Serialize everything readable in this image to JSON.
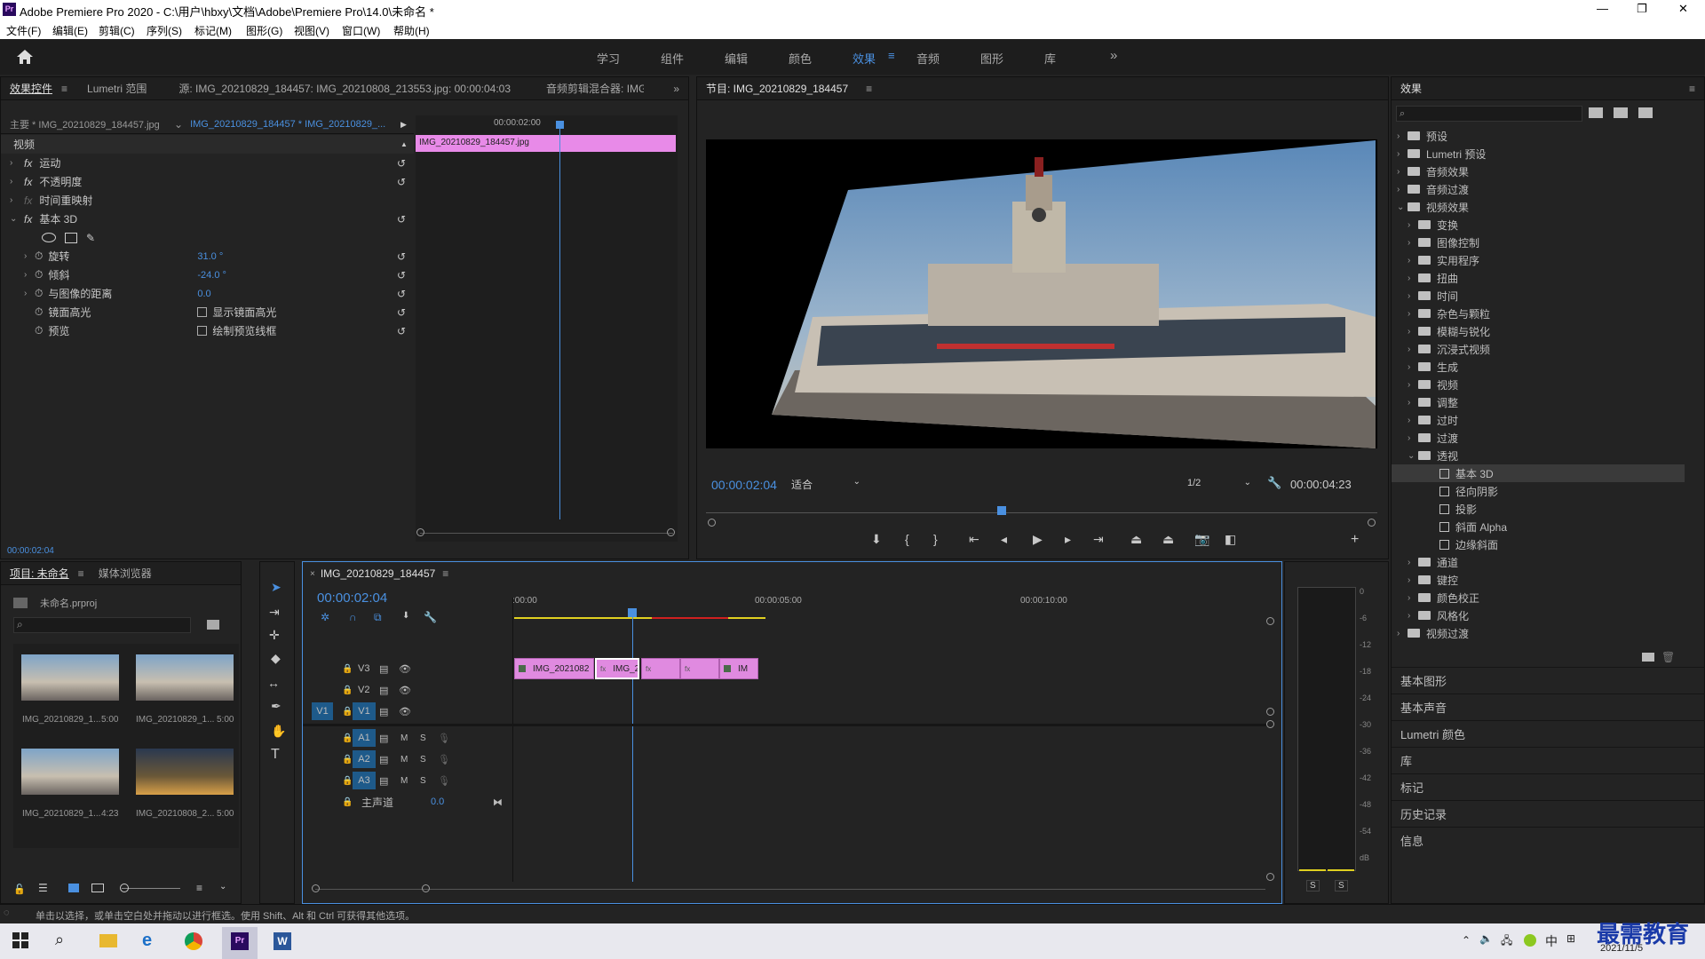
{
  "titlebar": {
    "title": "Adobe Premiere Pro 2020 - C:\\用户\\hbxy\\文档\\Adobe\\Premiere Pro\\14.0\\未命名 *",
    "minimize": "—",
    "maximize": "❐",
    "close": "✕"
  },
  "menu": [
    "文件(F)",
    "编辑(E)",
    "剪辑(C)",
    "序列(S)",
    "标记(M)",
    "图形(G)",
    "视图(V)",
    "窗口(W)",
    "帮助(H)"
  ],
  "workspaces": [
    "学习",
    "组件",
    "编辑",
    "颜色",
    "效果",
    "音频",
    "图形",
    "库"
  ],
  "active_workspace": "效果",
  "effect_controls": {
    "tabs": [
      "效果控件",
      "Lumetri 范围",
      "源: IMG_20210829_184457: IMG_20210808_213553.jpg: 00:00:04:03",
      "音频剪辑混合器: IMG_2("
    ],
    "master": "主要 * IMG_20210829_184457.jpg",
    "sequence": "IMG_20210829_184457 * IMG_20210829_...",
    "timecode_ruler": "00:00:02:00",
    "clip_name": "IMG_20210829_184457.jpg",
    "video_header": "视频",
    "rows": [
      {
        "label": "运动"
      },
      {
        "label": "不透明度"
      },
      {
        "label": "时间重映射"
      },
      {
        "label": "基本 3D"
      }
    ],
    "params": [
      {
        "label": "旋转",
        "value": "31.0 °"
      },
      {
        "label": "倾斜",
        "value": "-24.0 °"
      },
      {
        "label": "与图像的距离",
        "value": "0.0"
      },
      {
        "label": "镜面高光",
        "value": "显示镜面高光"
      },
      {
        "label": "预览",
        "value": "绘制预览线框"
      }
    ],
    "current_time": "00:00:02:04"
  },
  "program": {
    "title": "节目: IMG_20210829_184457",
    "timecode": "00:00:02:04",
    "fit": "适合",
    "resolution": "1/2",
    "duration": "00:00:04:23",
    "playhead_fraction": 0.44
  },
  "effects_panel": {
    "title": "效果",
    "tree": [
      {
        "label": "预设",
        "level": 0,
        "type": "folder",
        "open": false
      },
      {
        "label": "Lumetri 预设",
        "level": 0,
        "type": "folder",
        "open": false
      },
      {
        "label": "音频效果",
        "level": 0,
        "type": "folder",
        "open": false
      },
      {
        "label": "音频过渡",
        "level": 0,
        "type": "folder",
        "open": false
      },
      {
        "label": "视频效果",
        "level": 0,
        "type": "folder",
        "open": true
      },
      {
        "label": "变换",
        "level": 1,
        "type": "folder",
        "open": false
      },
      {
        "label": "图像控制",
        "level": 1,
        "type": "folder",
        "open": false
      },
      {
        "label": "实用程序",
        "level": 1,
        "type": "folder",
        "open": false
      },
      {
        "label": "扭曲",
        "level": 1,
        "type": "folder",
        "open": false
      },
      {
        "label": "时间",
        "level": 1,
        "type": "folder",
        "open": false
      },
      {
        "label": "杂色与颗粒",
        "level": 1,
        "type": "folder",
        "open": false
      },
      {
        "label": "模糊与锐化",
        "level": 1,
        "type": "folder",
        "open": false
      },
      {
        "label": "沉浸式视频",
        "level": 1,
        "type": "folder",
        "open": false
      },
      {
        "label": "生成",
        "level": 1,
        "type": "folder",
        "open": false
      },
      {
        "label": "视频",
        "level": 1,
        "type": "folder",
        "open": false
      },
      {
        "label": "调整",
        "level": 1,
        "type": "folder",
        "open": false
      },
      {
        "label": "过时",
        "level": 1,
        "type": "folder",
        "open": false
      },
      {
        "label": "过渡",
        "level": 1,
        "type": "folder",
        "open": false
      },
      {
        "label": "透视",
        "level": 1,
        "type": "folder",
        "open": true
      },
      {
        "label": "基本 3D",
        "level": 2,
        "type": "preset",
        "selected": true
      },
      {
        "label": "径向阴影",
        "level": 2,
        "type": "preset"
      },
      {
        "label": "投影",
        "level": 2,
        "type": "preset"
      },
      {
        "label": "斜面 Alpha",
        "level": 2,
        "type": "preset"
      },
      {
        "label": "边缘斜面",
        "level": 2,
        "type": "preset"
      },
      {
        "label": "通道",
        "level": 1,
        "type": "folder",
        "open": false
      },
      {
        "label": "键控",
        "level": 1,
        "type": "folder",
        "open": false
      },
      {
        "label": "颜色校正",
        "level": 1,
        "type": "folder",
        "open": false
      },
      {
        "label": "风格化",
        "level": 1,
        "type": "folder",
        "open": false
      },
      {
        "label": "视频过渡",
        "level": 0,
        "type": "folder",
        "open": false
      }
    ],
    "sections": [
      "基本图形",
      "基本声音",
      "Lumetri 颜色",
      "库",
      "标记",
      "历史记录",
      "信息"
    ]
  },
  "project": {
    "tabs": [
      "项目: 未命名",
      "媒体浏览器"
    ],
    "file": "未命名.prproj",
    "items": [
      {
        "name": "IMG_20210829_1...",
        "dur": "5:00"
      },
      {
        "name": "IMG_20210829_1...",
        "dur": "5:00"
      },
      {
        "name": "IMG_20210829_1...",
        "dur": "4:23"
      },
      {
        "name": "IMG_20210808_2...",
        "dur": "5:00"
      }
    ]
  },
  "timeline": {
    "tab": "IMG_20210829_184457",
    "timecode": "00:00:02:04",
    "ruler": [
      ":00:00",
      "00:00:05:00",
      "00:00:10:00"
    ],
    "video_tracks": [
      "V3",
      "V2",
      "V1"
    ],
    "audio_tracks": [
      "A1",
      "A2",
      "A3"
    ],
    "source_patch": "V1",
    "master": "主声道",
    "master_value": "0.0",
    "clips": [
      "IMG_2021082",
      "IMG_2",
      "fx",
      "fx",
      "IM"
    ],
    "mute": "M",
    "solo": "S"
  },
  "meter_scale": [
    "0",
    "-6",
    "-12",
    "-18",
    "-24",
    "-30",
    "-36",
    "-42",
    "-48",
    "-54",
    "dB"
  ],
  "meter_buttons": [
    "S",
    "S"
  ],
  "status": "单击以选择，或单击空白处并拖动以进行框选。使用 Shift、Alt 和 Ctrl 可获得其他选项。",
  "taskbar": {
    "ime": "中",
    "date": "2021/11/5",
    "watermark": "最需教育"
  }
}
